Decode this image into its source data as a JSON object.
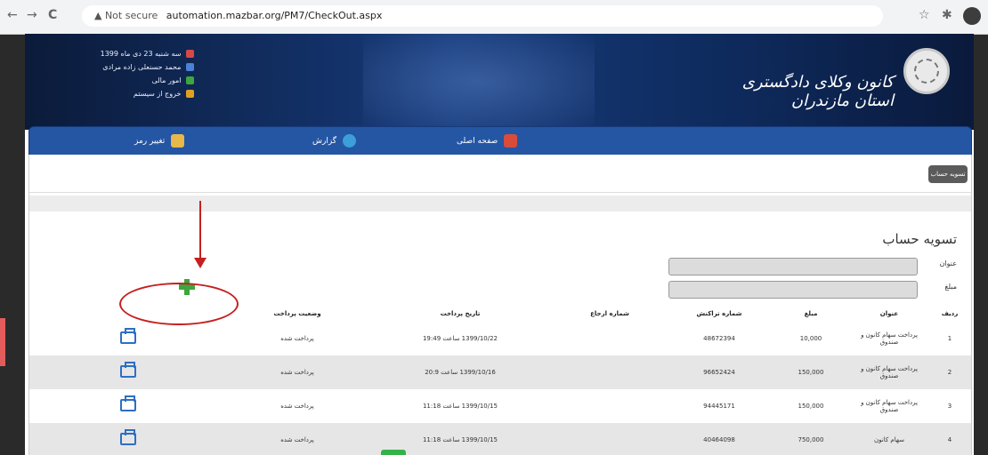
{
  "browser": {
    "back": "←",
    "forward": "→",
    "reload": "C",
    "security": "▲ Not secure",
    "url": "automation.mazbar.org/PM7/CheckOut.aspx",
    "star": "☆",
    "ext": "✱"
  },
  "header": {
    "org_name": "کانون وکلای دادگستری استان مازندران",
    "info": [
      {
        "text": "سه شنبه 23 دی ماه 1399",
        "icon": "calendar-icon",
        "color": "#d64848"
      },
      {
        "text": "محمد حسنعلی زاده مرادی",
        "icon": "user-icon",
        "color": "#4a82d6"
      },
      {
        "text": "امور مالی",
        "icon": "group-icon",
        "color": "#3ea63e"
      },
      {
        "text": "خروج از سیستم",
        "icon": "exit-icon",
        "color": "#e0a020"
      }
    ]
  },
  "menu": {
    "items": [
      {
        "label": "صفحه اصلی",
        "icon": "home-icon",
        "color": "#d94c3c"
      },
      {
        "label": "گزارش",
        "icon": "chart-icon",
        "color": "#3c9fd9"
      },
      {
        "label": "تغییر رمز",
        "icon": "edit-icon",
        "color": "#e8b84a"
      }
    ]
  },
  "tab": {
    "label": "تسویه حساب"
  },
  "form": {
    "title": "تسویه حساب",
    "fields": [
      {
        "label": "عنوان"
      },
      {
        "label": "مبلغ"
      }
    ]
  },
  "table": {
    "columns": [
      "ردیف",
      "عنوان",
      "مبلغ",
      "شماره تراکنش",
      "شماره ارجاع",
      "تاریخ پرداخت",
      "وضعیت پرداخت",
      ""
    ],
    "rows": [
      {
        "index": "1",
        "title": "پرداخت سهام کانون و صندوق",
        "amount": "10,000",
        "tx": "48672394",
        "ref": "",
        "date": "1399/10/22 ساعت 19:49",
        "status": "پرداخت شده"
      },
      {
        "index": "2",
        "title": "پرداخت سهام کانون و صندوق",
        "amount": "150,000",
        "tx": "96652424",
        "ref": "",
        "date": "1399/10/16 ساعت 20:9",
        "status": "پرداخت شده"
      },
      {
        "index": "3",
        "title": "پرداخت سهام کانون و صندوق",
        "amount": "150,000",
        "tx": "94445171",
        "ref": "",
        "date": "1399/10/15 ساعت 11:18",
        "status": "پرداخت شده"
      },
      {
        "index": "4",
        "title": "سهام کانون",
        "amount": "750,000",
        "tx": "40464098",
        "ref": "",
        "date": "1399/10/15 ساعت 11:18",
        "status": "پرداخت شده"
      }
    ]
  }
}
